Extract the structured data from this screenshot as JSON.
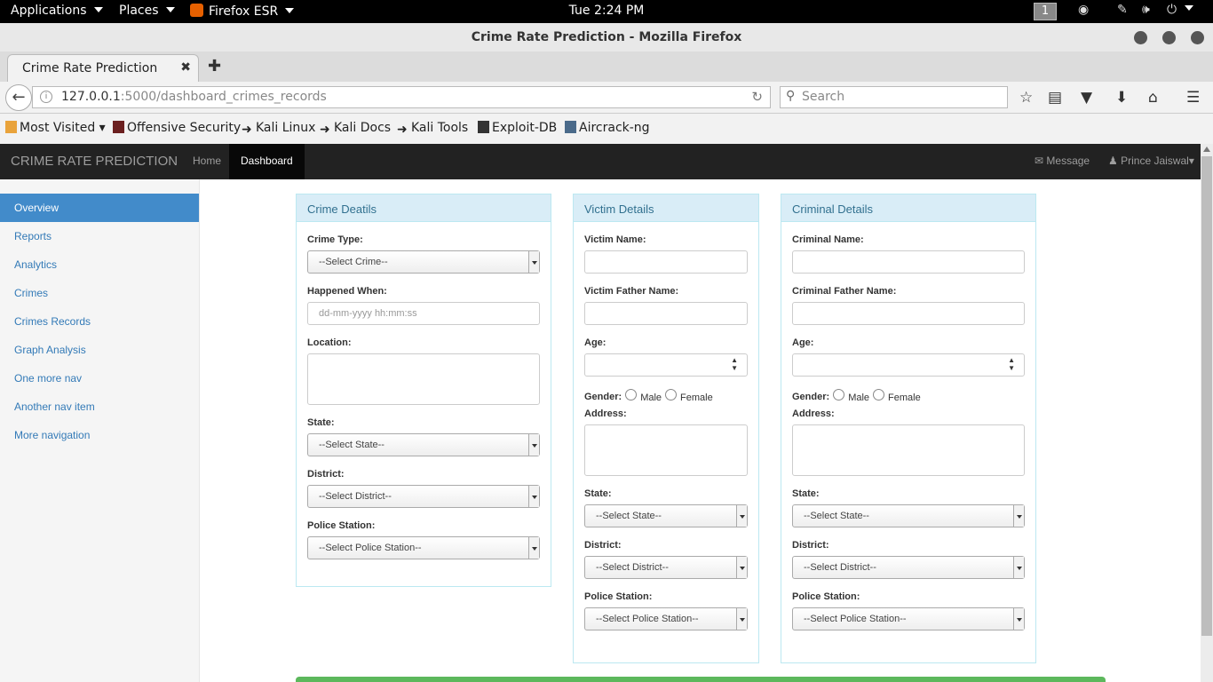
{
  "os": {
    "applications": "Applications",
    "places": "Places",
    "firefox_esr": "Firefox ESR",
    "clock": "Tue  2:24 PM",
    "workspace": "1"
  },
  "window": {
    "title": "Crime Rate Prediction - Mozilla Firefox"
  },
  "tab": {
    "label": "Crime Rate Prediction"
  },
  "url": {
    "host": "127.0.0.1",
    "path": ":5000/dashboard_crimes_records"
  },
  "search_placeholder": "Search",
  "bookmarks": [
    "Most Visited",
    "Offensive Security",
    "Kali Linux",
    "Kali Docs",
    "Kali Tools",
    "Exploit-DB",
    "Aircrack-ng"
  ],
  "topnav": {
    "brand": "CRIME RATE PREDICTION",
    "home": "Home",
    "dashboard": "Dashboard",
    "message": "Message",
    "user": "Prince Jaiswal"
  },
  "sidebar": [
    "Overview",
    "Reports",
    "Analytics",
    "Crimes",
    "Crimes Records",
    "Graph Analysis",
    "One more nav",
    "Another nav item",
    "More navigation"
  ],
  "crime": {
    "title": "Crime Deatils",
    "crime_type_label": "Crime Type:",
    "crime_type_value": "--Select Crime--",
    "happened_label": "Happened When:",
    "happened_placeholder": "dd-mm-yyyy hh:mm:ss",
    "location_label": "Location:",
    "state_label": "State:",
    "state_value": "--Select State--",
    "district_label": "District:",
    "district_value": "--Select District--",
    "station_label": "Police Station:",
    "station_value": "--Select Police Station--"
  },
  "victim": {
    "title": "Victim Details",
    "name_label": "Victim Name:",
    "father_label": "Victim Father Name:",
    "age_label": "Age:",
    "gender_label": "Gender:",
    "male": "Male",
    "female": "Female",
    "address_label": "Address:",
    "state_label": "State:",
    "state_value": "--Select State--",
    "district_label": "District:",
    "district_value": "--Select District--",
    "station_label": "Police Station:",
    "station_value": "--Select Police Station--"
  },
  "criminal": {
    "title": "Criminal Details",
    "name_label": "Criminal Name:",
    "father_label": "Criminal Father Name:",
    "age_label": "Age:",
    "gender_label": "Gender:",
    "male": "Male",
    "female": "Female",
    "address_label": "Address:",
    "state_label": "State:",
    "state_value": "--Select State--",
    "district_label": "District:",
    "district_value": "--Select District--",
    "station_label": "Police Station:",
    "station_value": "--Select Police Station--"
  },
  "colors": {
    "nav_bg": "#222222",
    "sidebar_active": "#428bca",
    "panel_header": "#d9edf7",
    "save_bar": "#5cb85c"
  }
}
